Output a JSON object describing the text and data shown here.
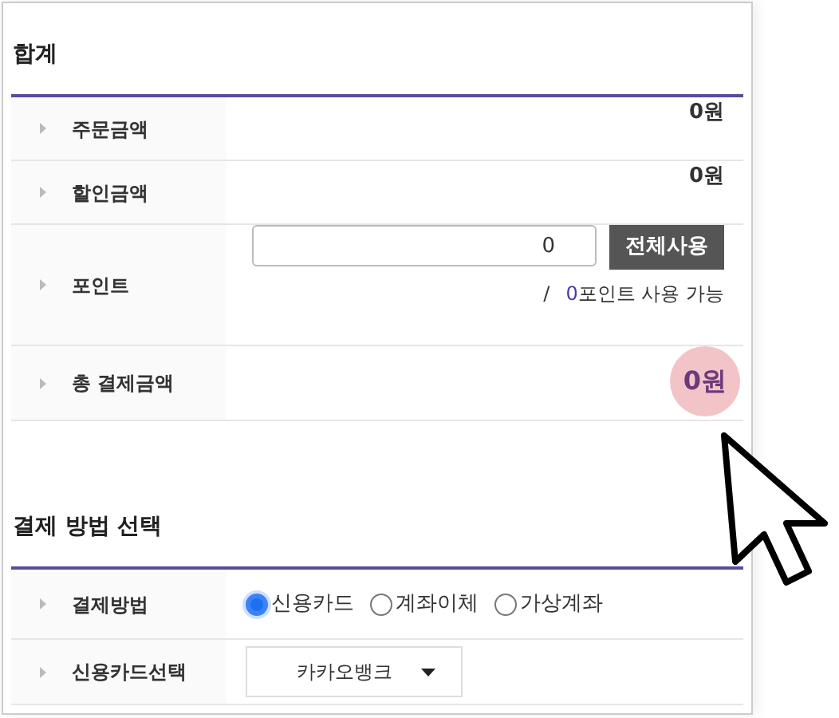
{
  "sections": [
    {
      "title": "합계",
      "rows": [
        {
          "kind": "amount",
          "label": "주문금액",
          "value": "0원"
        },
        {
          "kind": "amount",
          "label": "할인금액",
          "value": "0원"
        },
        {
          "kind": "point",
          "label": "포인트",
          "input_value": "0",
          "button": "전체사용",
          "separator": "/",
          "available_count": "0",
          "available_text": "포인트 사용 가능"
        },
        {
          "kind": "total",
          "label": "총 결제금액",
          "value": "0원"
        }
      ]
    },
    {
      "title": "결제 방법 선택",
      "rows": [
        {
          "kind": "radio",
          "label": "결제방법",
          "options": [
            {
              "label": "신용카드",
              "selected": true
            },
            {
              "label": "계좌이체",
              "selected": false
            },
            {
              "label": "가상계좌",
              "selected": false
            }
          ]
        },
        {
          "kind": "select",
          "label": "신용카드선택",
          "value": "카카오뱅크"
        }
      ]
    }
  ]
}
